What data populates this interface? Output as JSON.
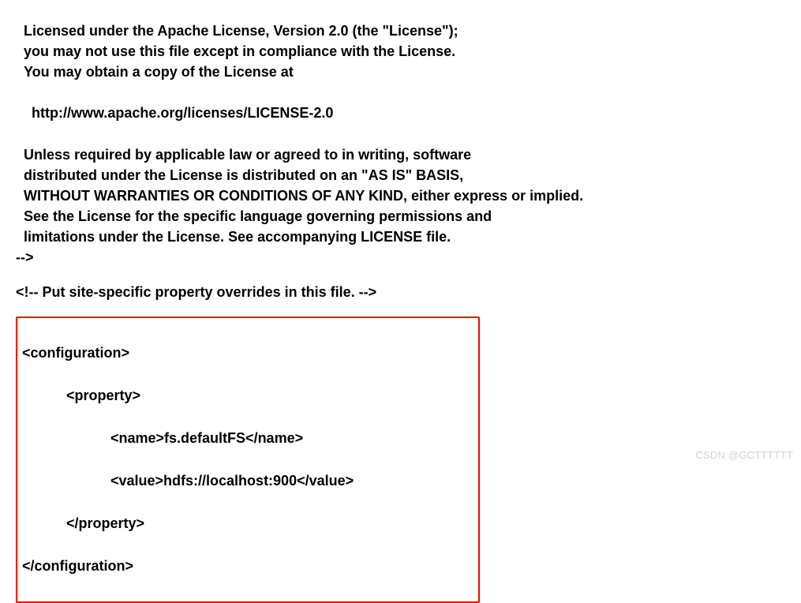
{
  "license": {
    "line1": "Licensed under the Apache License, Version 2.0 (the \"License\");",
    "line2": "you may not use this file except in compliance with the License.",
    "line3": "You may obtain a copy of the License at",
    "url": "  http://www.apache.org/licenses/LICENSE-2.0",
    "line4": "Unless required by applicable law or agreed to in writing, software",
    "line5": "distributed under the License is distributed on an \"AS IS\" BASIS,",
    "line6": "WITHOUT WARRANTIES OR CONDITIONS OF ANY KIND, either express or implied.",
    "line7": "See the License for the specific language governing permissions and",
    "line8": "limitations under the License. See accompanying LICENSE file."
  },
  "comment_close": "-->",
  "site_specific_comment": "<!-- Put site-specific property overrides in this file. -->",
  "config": {
    "open": "<configuration>",
    "prop_open": "<property>",
    "name": "<name>fs.defaultFS</name>",
    "value": "<value>hdfs://localhost:900</value>",
    "prop_close": "</property>",
    "close": "</configuration>"
  },
  "watermark": "CSDN @GCTTTTTT"
}
